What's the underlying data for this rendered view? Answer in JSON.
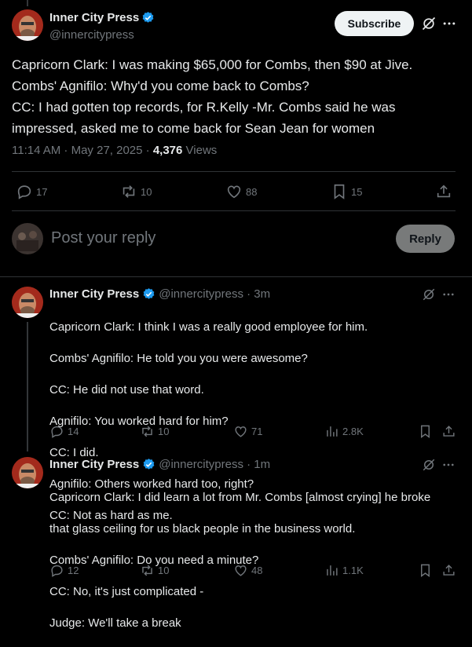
{
  "main_tweet": {
    "author_name": "Inner City Press",
    "handle": "@innercitypress",
    "subscribe_label": "Subscribe",
    "lines": [
      "Capricorn Clark: I was making $65,000 for Combs, then $90 at Jive.",
      "Combs' Agnifilo: Why'd you come back to Combs?",
      "CC: I had gotten top records, for R.Kelly -Mr. Combs said he was",
      "impressed, asked me to come back for Sean Jean for women"
    ],
    "timestamp": "11:14 AM · May 27, 2025 · ",
    "views_count": "4,376",
    "views_label": " Views",
    "replies": "17",
    "reposts": "10",
    "likes": "88",
    "bookmarks": "15"
  },
  "reply_composer": {
    "placeholder": "Post your reply",
    "reply_button": "Reply"
  },
  "replies": [
    {
      "author_name": "Inner City Press",
      "handle_time": "@innercitypress · 3m",
      "lines": [
        "Capricorn Clark: I think I was a really good employee for him.",
        "Combs' Agnifilo: He told you you were awesome?",
        "CC: He did not use that word.",
        "Agnifilo: You worked hard for him?",
        "CC: I did.",
        "Agnifilo: Others worked hard too, right?",
        "CC: Not as hard as me."
      ],
      "replies": "14",
      "reposts": "10",
      "likes": "71",
      "views": "2.8K"
    },
    {
      "author_name": "Inner City Press",
      "handle_time": "@innercitypress · 1m",
      "lines": [
        "Capricorn Clark: I did learn a lot from Mr. Combs [almost crying] he broke",
        "that glass ceiling for us black people in the business world.",
        "Combs' Agnifilo: Do you need a minute?",
        "CC: No, it's just complicated -",
        "Judge: We'll take a break"
      ],
      "replies": "12",
      "reposts": "10",
      "likes": "48",
      "views": "1.1K"
    }
  ],
  "colors": {
    "background": "#000000",
    "text": "#e7e9ea",
    "muted": "#71767b",
    "verified": "#1d9bf0",
    "divider": "#2f3336"
  },
  "icons": [
    "verified-badge-icon",
    "grok-icon",
    "more-icon",
    "reply-icon",
    "repost-icon",
    "like-icon",
    "bookmark-icon",
    "share-icon",
    "views-icon"
  ]
}
